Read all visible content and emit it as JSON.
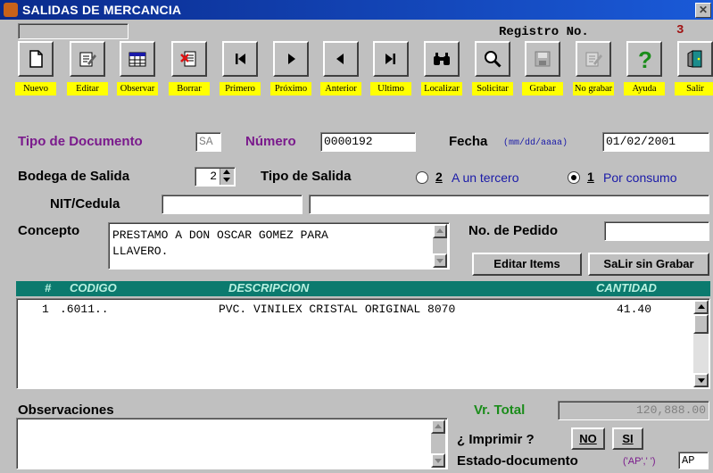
{
  "window": {
    "title": "SALIDAS DE MERCANCIA",
    "close": "✕"
  },
  "header": {
    "registro_label": "Registro No.",
    "registro_value": "3"
  },
  "toolbar": [
    {
      "label": "Nuevo",
      "icon": "new-document-icon"
    },
    {
      "label": "Editar",
      "icon": "edit-icon"
    },
    {
      "label": "Observar",
      "icon": "browse-table-icon"
    },
    {
      "label": "Borrar",
      "icon": "delete-icon"
    },
    {
      "label": "Primero",
      "icon": "first-icon"
    },
    {
      "label": "Próximo",
      "icon": "next-icon"
    },
    {
      "label": "Anterior",
      "icon": "previous-icon"
    },
    {
      "label": "Ultimo",
      "icon": "last-icon"
    },
    {
      "label": "Localizar",
      "icon": "binoculars-icon"
    },
    {
      "label": "Solicitar",
      "icon": "magnifier-icon"
    },
    {
      "label": "Grabar",
      "icon": "save-icon"
    },
    {
      "label": "No grabar",
      "icon": "no-save-icon"
    },
    {
      "label": "Ayuda",
      "icon": "help-icon"
    },
    {
      "label": "Salir",
      "icon": "exit-door-icon"
    }
  ],
  "form": {
    "tipo_doc_label": "Tipo de Documento",
    "tipo_doc_value": "SA",
    "numero_label": "Número",
    "numero_value": "0000192",
    "fecha_label": "Fecha",
    "fecha_format": "(mm/dd/aaaa)",
    "fecha_value": "01/02/2001",
    "bodega_label": "Bodega de Salida",
    "bodega_value": "2",
    "tipo_salida_label": "Tipo de Salida",
    "opcion_tercero_num": "2",
    "opcion_tercero_text": "A un tercero",
    "opcion_consumo_num": "1",
    "opcion_consumo_text": "Por consumo",
    "nit_label": "NIT/Cedula",
    "nit_value": "",
    "nit_name_value": "",
    "concepto_label": "Concepto",
    "concepto_line1": "PRESTAMO A DON OSCAR GOMEZ PARA",
    "concepto_line2": "LLAVERO.",
    "pedido_label": "No. de Pedido",
    "pedido_value": "",
    "editar_items_label": "Editar Items",
    "salir_sin_grabar_label": "SaLir sin Grabar"
  },
  "grid": {
    "columns": [
      "#",
      "CODIGO",
      "DESCRIPCION",
      "CANTIDAD"
    ],
    "rows": [
      {
        "n": "1",
        "codigo": ".6011..",
        "descripcion": "PVC. VINILEX CRISTAL ORIGINAL 8070",
        "cantidad": "41.40"
      }
    ]
  },
  "footer": {
    "observaciones_label": "Observaciones",
    "observaciones_value": "",
    "vr_total_label": "Vr. Total",
    "vr_total_value": "120,888.00",
    "imprimir_label": "¿ Imprimir ?",
    "no_label": "NO",
    "si_label": "SI",
    "estado_label": "Estado-documento",
    "estado_hint": "('AP',' ')",
    "estado_value": "AP"
  },
  "colors": {
    "title_bar": "#0a2a8c",
    "label_purple": "#7a1a8c",
    "green": "#1a8c1a",
    "blue": "#1a1aa8",
    "grid_header": "#0b7a6e",
    "toolbar_label_bg": "#ffff00"
  }
}
